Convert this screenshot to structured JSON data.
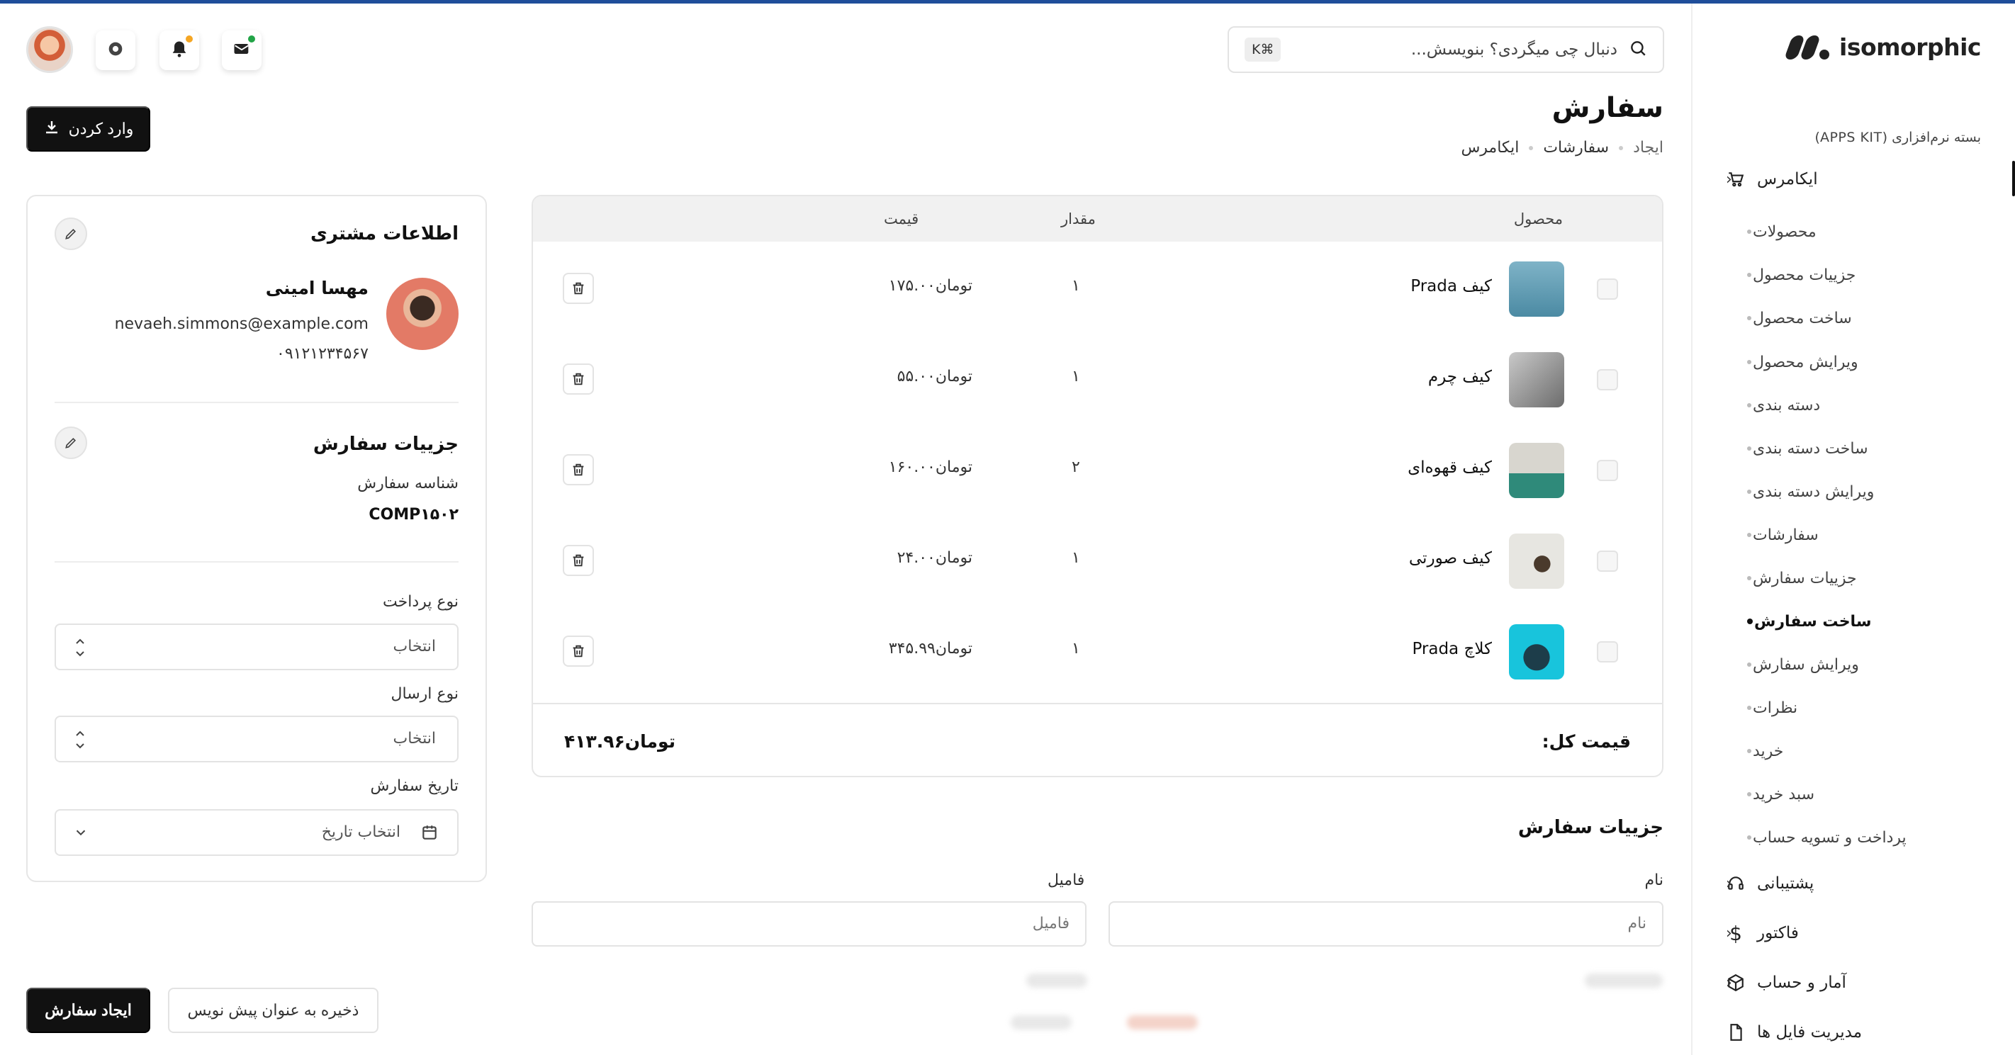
{
  "brand": {
    "name": "isomorphic"
  },
  "sidebar": {
    "kit_label": "بسته نرم‌افزاری (APPS KIT)",
    "main_items": [
      {
        "label": "ایکامرس",
        "icon": "cart-icon"
      },
      {
        "label": "پشتیبانی",
        "icon": "headset-icon"
      },
      {
        "label": "فاکتور",
        "icon": "dollar-icon"
      },
      {
        "label": "آمار و حساب",
        "icon": "box-icon"
      },
      {
        "label": "مدیریت فایل ها",
        "icon": "file-icon"
      }
    ],
    "sub_items": [
      "محصولات",
      "جزییات محصول",
      "ساخت محصول",
      "ویرایش محصول",
      "دسته بندی",
      "ساخت دسته بندی",
      "ویرایش دسته بندی",
      "سفارشات",
      "جزییات سفارش",
      "ساخت سفارش",
      "ویرایش سفارش",
      "نظرات",
      "خرید",
      "سبد خرید",
      "پرداخت و تسویه حساب"
    ],
    "active_sub_item": "ساخت سفارش"
  },
  "header": {
    "search_placeholder": "دنبال چی میگردی؟ بنویسش...",
    "shortcut": "K⌘"
  },
  "page": {
    "title": "سفارش",
    "breadcrumb": [
      "ایکامرس",
      "سفارشات",
      "ایجاد"
    ],
    "import_label": "وارد کردن"
  },
  "table": {
    "headers": {
      "product": "محصول",
      "qty": "مقدار",
      "price": "قیمت"
    },
    "rows": [
      {
        "name": "کیف Prada",
        "qty": "۱",
        "price": "تومان۱۷۵.۰۰"
      },
      {
        "name": "کیف چرم",
        "qty": "۱",
        "price": "تومان۵۵.۰۰"
      },
      {
        "name": "کیف قهوه‌ای",
        "qty": "۲",
        "price": "تومان۱۶۰.۰۰"
      },
      {
        "name": "کیف صورتی",
        "qty": "۱",
        "price": "تومان۲۴.۰۰"
      },
      {
        "name": "کلاچ Prada",
        "qty": "۱",
        "price": "تومان۳۴۵.۹۹"
      }
    ],
    "total_label": "قیمت کل:",
    "total_value": "تومان۴۱۳.۹۶"
  },
  "order_form": {
    "title": "جزییات سفارش",
    "first_name_label": "نام",
    "first_name_placeholder": "نام",
    "last_name_label": "فامیل",
    "last_name_placeholder": "فامیل"
  },
  "customer": {
    "title": "اطلاعات مشتری",
    "name": "مهسا امینی",
    "email": "nevaeh.simmons@example.com",
    "phone": "۰۹۱۲۱۲۳۴۵۶۷",
    "order_details_title": "جزییات سفارش",
    "order_id_label": "شناسه سفارش",
    "order_id": "COMP۱۵۰۲",
    "payment_label": "نوع پرداخت",
    "payment_value": "انتخاب",
    "shipping_label": "نوع ارسال",
    "shipping_value": "انتخاب",
    "date_label": "تاریخ سفارش",
    "date_value": "انتخاب تاریخ"
  },
  "actions": {
    "draft_label": "ذخیره به عنوان پیش نویس",
    "create_label": "ایجاد سفارش"
  },
  "colors": {
    "accent": "#111111",
    "top_line": "#1f4e9a",
    "notify_badge": "#f5a623",
    "message_badge": "#22a447"
  }
}
